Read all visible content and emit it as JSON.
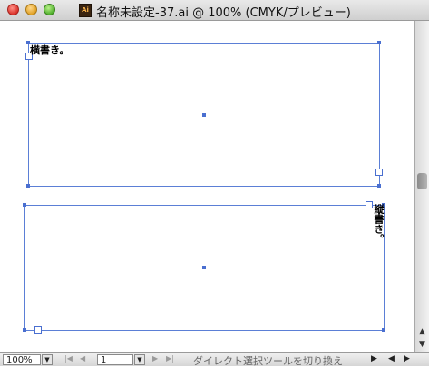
{
  "window": {
    "title": "名称未設定-37.ai @ 100% (CMYK/プレビュー)",
    "app_icon_text": "Ai"
  },
  "canvas": {
    "horizontal_text": "横書き。",
    "vertical_text": "縦書き。"
  },
  "statusbar": {
    "zoom": "100%",
    "page": "1",
    "status": "ダイレクト選択ツールを切り換え"
  },
  "icons": {
    "close": "close-button",
    "minimize": "minimize-button",
    "maximize": "zoom-button",
    "first_page": "first-page-icon",
    "prev_page": "prev-page-icon",
    "next_page": "next-page-icon",
    "last_page": "last-page-icon"
  }
}
